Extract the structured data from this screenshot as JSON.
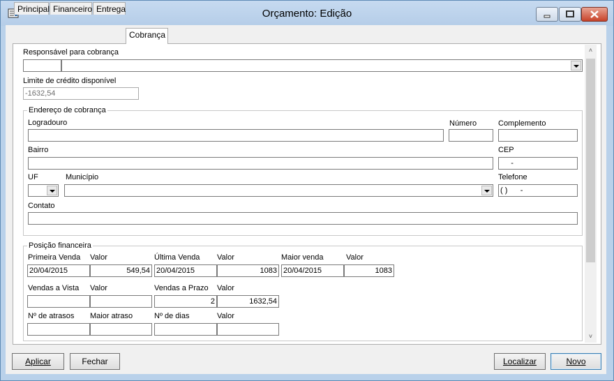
{
  "window": {
    "title": "Orçamento: Edição"
  },
  "tabs": [
    "Principal",
    "Financeiro",
    "Entrega",
    "Cobrança"
  ],
  "responsavel": {
    "label": "Responsável para cobrança",
    "code": "",
    "name": ""
  },
  "limite": {
    "label": "Limite de crédito disponível",
    "value": "-1632,54"
  },
  "endereco": {
    "title": "Endereço de cobrança",
    "logradouro_label": "Logradouro",
    "logradouro": "",
    "numero_label": "Número",
    "numero": "",
    "complemento_label": "Complemento",
    "complemento": "",
    "bairro_label": "Bairro",
    "bairro": "",
    "cep_label": "CEP",
    "cep": "     -",
    "uf_label": "UF",
    "uf": "",
    "municipio_label": "Município",
    "municipio": "",
    "telefone_label": "Telefone",
    "telefone": "( )      -",
    "contato_label": "Contato",
    "contato": ""
  },
  "posicao": {
    "title": "Posição financeira",
    "primeira_venda_label": "Primeira Venda",
    "primeira_venda": "20/04/2015",
    "valor1_label": "Valor",
    "valor1": "549,54",
    "ultima_venda_label": "Última Venda",
    "ultima_venda": "20/04/2015",
    "valor2_label": "Valor",
    "valor2": "1083",
    "maior_venda_label": "Maior venda",
    "maior_venda": "20/04/2015",
    "valor3_label": "Valor",
    "valor3": "1083",
    "vendas_vista_label": "Vendas a Vista",
    "vendas_vista": "",
    "valor4_label": "Valor",
    "valor4": "",
    "vendas_prazo_label": "Vendas a Prazo",
    "vendas_prazo": "2",
    "valor5_label": "Valor",
    "valor5": "1632,54",
    "atrasos_label": "Nº de atrasos",
    "atrasos": "",
    "maior_atraso_label": "Maior atraso",
    "maior_atraso": "",
    "dias_label": "Nº de dias",
    "dias": "",
    "valor6_label": "Valor",
    "valor6": ""
  },
  "buttons": {
    "aplicar": "Aplicar",
    "fechar": "Fechar",
    "localizar": "Localizar",
    "novo": "Novo"
  },
  "icons": {
    "app": "app-icon",
    "minimize": "minimize-icon",
    "maximize": "maximize-icon",
    "close": "close-icon",
    "scroll_up": "scroll-up-icon",
    "scroll_down": "scroll-down-icon"
  }
}
